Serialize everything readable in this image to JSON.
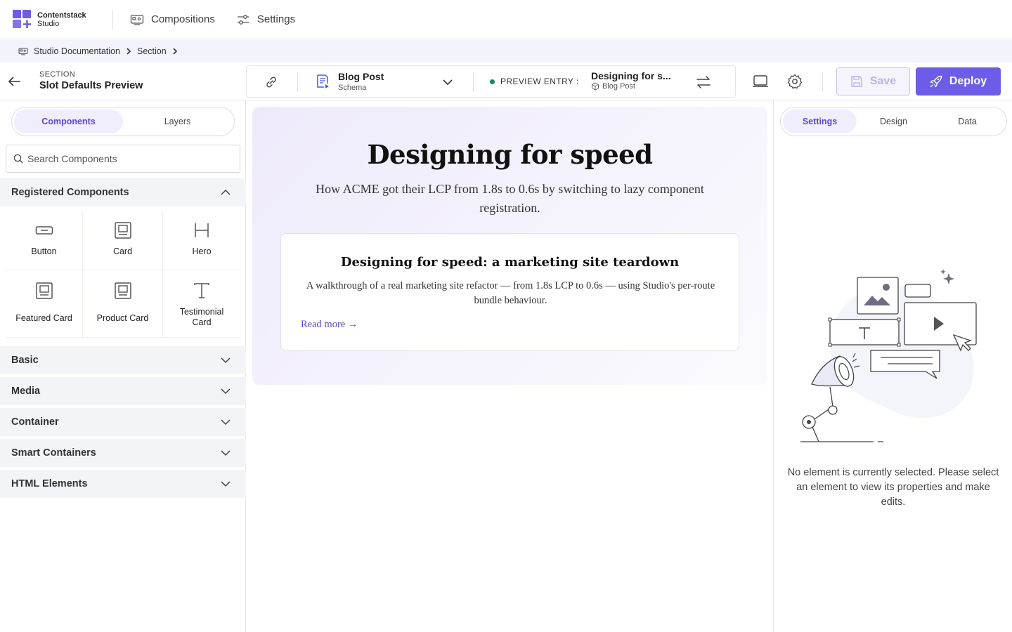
{
  "app": {
    "logo_line1": "Contentstack",
    "logo_line2": "Studio",
    "nav": [
      {
        "label": "Compositions",
        "icon": "compositions-icon"
      },
      {
        "label": "Settings",
        "icon": "sliders-icon"
      }
    ]
  },
  "breadcrumb": {
    "items": [
      "Studio Documentation",
      "Section"
    ]
  },
  "toolbar": {
    "section_label": "SECTION",
    "section_name": "Slot Defaults Preview",
    "schema_name": "Blog Post",
    "schema_sub": "Schema",
    "preview_label": "PREVIEW ENTRY :",
    "entry_name": "Designing for s...",
    "entry_type": "Blog Post",
    "save_label": "Save",
    "deploy_label": "Deploy"
  },
  "left_panel": {
    "tabs": [
      "Components",
      "Layers"
    ],
    "search_placeholder": "Search Components",
    "registered_title": "Registered Components",
    "components": [
      {
        "label": "Button",
        "icon": "button-icon"
      },
      {
        "label": "Card",
        "icon": "card-icon"
      },
      {
        "label": "Hero",
        "icon": "hero-icon"
      },
      {
        "label": "Featured Card",
        "icon": "card-icon"
      },
      {
        "label": "Product Card",
        "icon": "card-icon"
      },
      {
        "label": "Testimonial Card",
        "icon": "text-icon"
      }
    ],
    "sections": [
      "Basic",
      "Media",
      "Container",
      "Smart Containers",
      "HTML Elements"
    ]
  },
  "canvas": {
    "hero_title": "Designing for speed",
    "hero_subtitle": "How ACME got their LCP from 1.8s to 0.6s by switching to lazy component registration.",
    "card_title": "Designing for speed: a marketing site teardown",
    "card_body": "A walkthrough of a real marketing site refactor — from 1.8s LCP to 0.6s — using Studio's per-route bundle behaviour.",
    "card_link": "Read more →"
  },
  "right_panel": {
    "tabs": [
      "Settings",
      "Design",
      "Data"
    ],
    "empty_message": "No element is currently selected. Please select an element to view its properties and make edits."
  },
  "colors": {
    "accent": "#6c5ce7",
    "accent_text": "#5b47d6",
    "live_dot": "#0e8a5c"
  }
}
